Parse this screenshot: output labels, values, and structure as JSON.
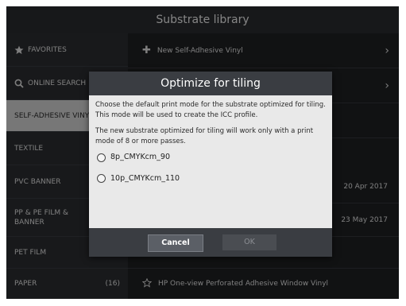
{
  "header": {
    "title": "Substrate library"
  },
  "sidebar": {
    "items": [
      {
        "label": "FAVORITES",
        "icon": "star-icon",
        "count": ""
      },
      {
        "label": "ONLINE SEARCH",
        "icon": "search-icon",
        "count": ""
      },
      {
        "label": "SELF-ADHESIVE VINYL",
        "icon": "",
        "count": ""
      },
      {
        "label": "TEXTILE",
        "icon": "",
        "count": ""
      },
      {
        "label": "PVC BANNER",
        "icon": "",
        "count": ""
      },
      {
        "label": "PP & PE FILM & BANNER",
        "icon": "",
        "count": ""
      },
      {
        "label": "PET FILM",
        "icon": "",
        "count": ""
      },
      {
        "label": "PAPER",
        "icon": "",
        "count": "(16)"
      }
    ]
  },
  "main": {
    "new_item": "New Self-Adhesive Vinyl",
    "rows": [
      {
        "date": "20 Apr 2017"
      },
      {
        "date": "23 May 2017"
      }
    ],
    "last_row_label": "HP One-view Perforated Adhesive Window Vinyl"
  },
  "dialog": {
    "title": "Optimize for tiling",
    "paragraph1": "Choose the default print mode for the substrate optimized for tiling. This mode will be used to create the ICC profile.",
    "paragraph2": "The new substrate optimized for tiling will work only with a print mode of 8 or more passes.",
    "options": [
      "8p_CMYKcm_90",
      "10p_CMYKcm_110"
    ],
    "cancel_label": "Cancel",
    "ok_label": "OK"
  },
  "colors": {
    "title_bar": "#2a2c30",
    "dialog_header": "#3a3d42",
    "selected_side": "#d9d9d9"
  }
}
